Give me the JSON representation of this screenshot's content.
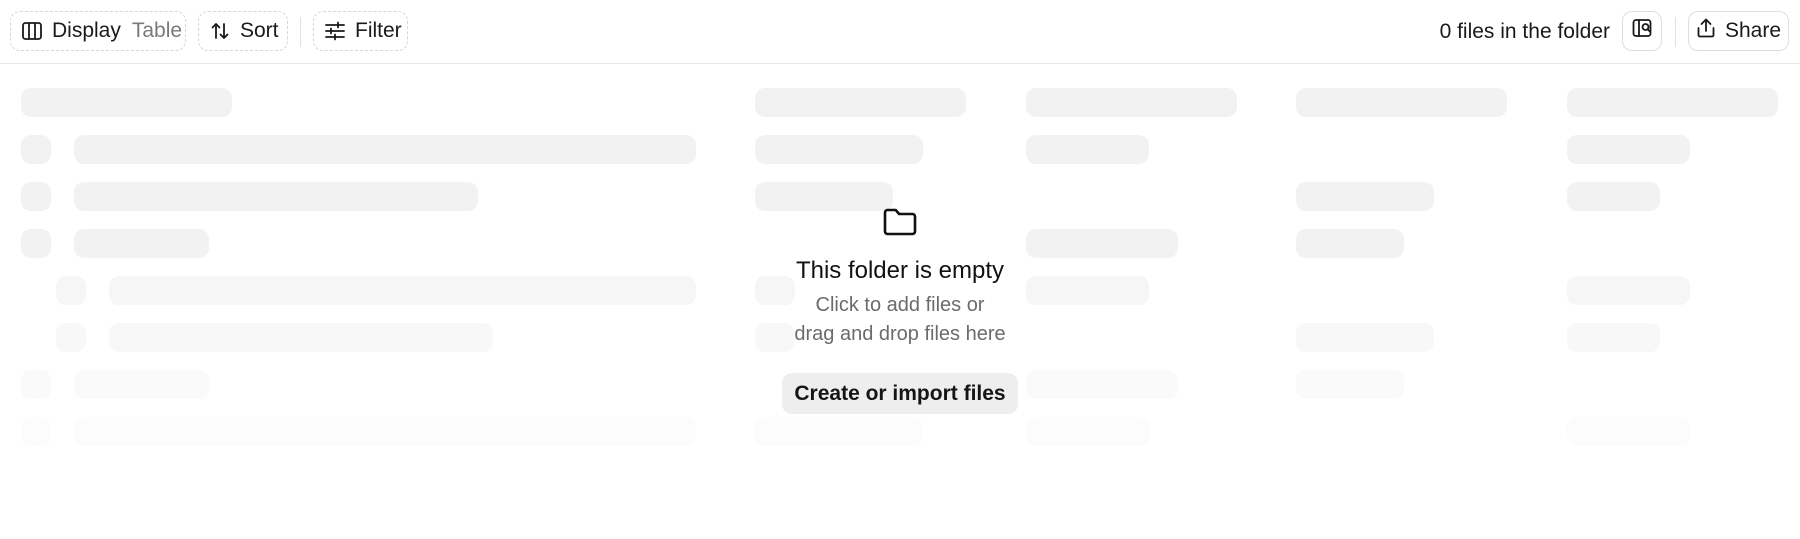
{
  "toolbar": {
    "display_label": "Display",
    "display_value": "Table",
    "sort_label": "Sort",
    "filter_label": "Filter",
    "files_count": "0 files in the folder",
    "share_label": "Share",
    "icons": {
      "display": "columns-icon",
      "sort": "sort-arrows-icon",
      "filter": "sliders-icon",
      "view_toggle": "board-search-icon",
      "share": "share-upload-icon"
    }
  },
  "empty_state": {
    "icon": "folder-icon",
    "title": "This folder is empty",
    "line1": "Click to add files or",
    "line2": "drag and drop files here",
    "button_label": "Create or import files"
  },
  "colors": {
    "skeleton": "#f2f2f2",
    "border": "#dedede",
    "muted_text": "#6b6b6b"
  }
}
